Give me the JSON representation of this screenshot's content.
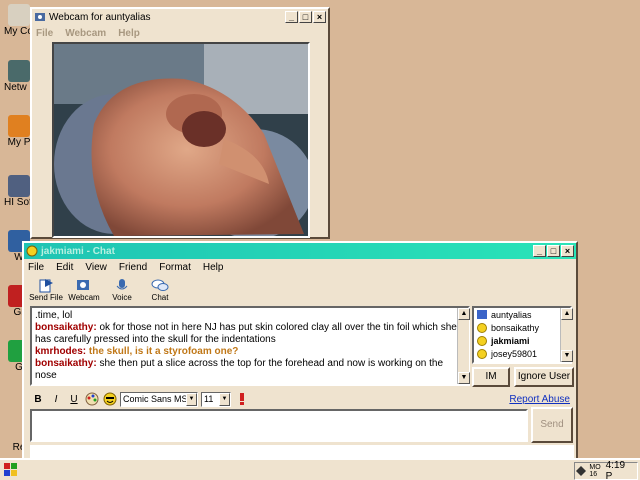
{
  "desktop": {
    "icons": [
      {
        "label": "My Comp",
        "color": "#d8d0c0"
      },
      {
        "label": "Netw Neigh",
        "color": "#4a6a6a"
      },
      {
        "label": "My P",
        "color": "#e08020"
      },
      {
        "label": "HI Softw",
        "color": "#506080"
      },
      {
        "label": "W",
        "color": "#3060a0"
      },
      {
        "label": "Gr",
        "color": "#c02020"
      },
      {
        "label": "G",
        "color": "#20a040"
      },
      {
        "label": "Re",
        "color": "#d8b797"
      }
    ]
  },
  "webcam_window": {
    "title": "Webcam for auntyalias",
    "menu": [
      "File",
      "Webcam",
      "Help"
    ],
    "controls": {
      "minimize": "_",
      "maximize": "□",
      "close": "×"
    }
  },
  "chat_window": {
    "title": "jakmiami - Chat",
    "menu": [
      "File",
      "Edit",
      "View",
      "Friend",
      "Format",
      "Help"
    ],
    "toolbar": [
      {
        "label": "Send File",
        "icon": "send-file-icon"
      },
      {
        "label": "Webcam",
        "icon": "webcam-icon"
      },
      {
        "label": "Voice",
        "icon": "voice-icon"
      },
      {
        "label": "Chat",
        "icon": "chat-icon"
      }
    ],
    "messages": [
      {
        "sender": "",
        "text": ".time, lol"
      },
      {
        "sender": "bonsaikathy:",
        "text": " ok for those not in here NJ has put skin colored clay all over the tin foil which she has carefully pressed into the skull for the indentations"
      },
      {
        "sender": "kmrhodes:",
        "text": " the skull, is it a styrofoam one?"
      },
      {
        "sender": "bonsaikathy:",
        "text": " she then put a slice across the top for the forehead and now is working on the nose"
      }
    ],
    "buddies": [
      {
        "name": "auntyalias",
        "icon": "mail-icon",
        "bold": false
      },
      {
        "name": "bonsaikathy",
        "icon": "smiley-icon",
        "bold": false
      },
      {
        "name": "jakmiami",
        "icon": "smiley-icon",
        "bold": true
      },
      {
        "name": "josey59801",
        "icon": "smiley-icon",
        "bold": false
      }
    ],
    "im_button": "IM",
    "ignore_button": "Ignore User",
    "format": {
      "bold": "B",
      "italic": "I",
      "underline": "U",
      "font": "Comic Sans MS",
      "size": "11"
    },
    "report_link": "Report Abuse",
    "send_button": "Send"
  },
  "taskbar": {
    "tray_day": "MO 16",
    "clock": "4:19 P"
  }
}
